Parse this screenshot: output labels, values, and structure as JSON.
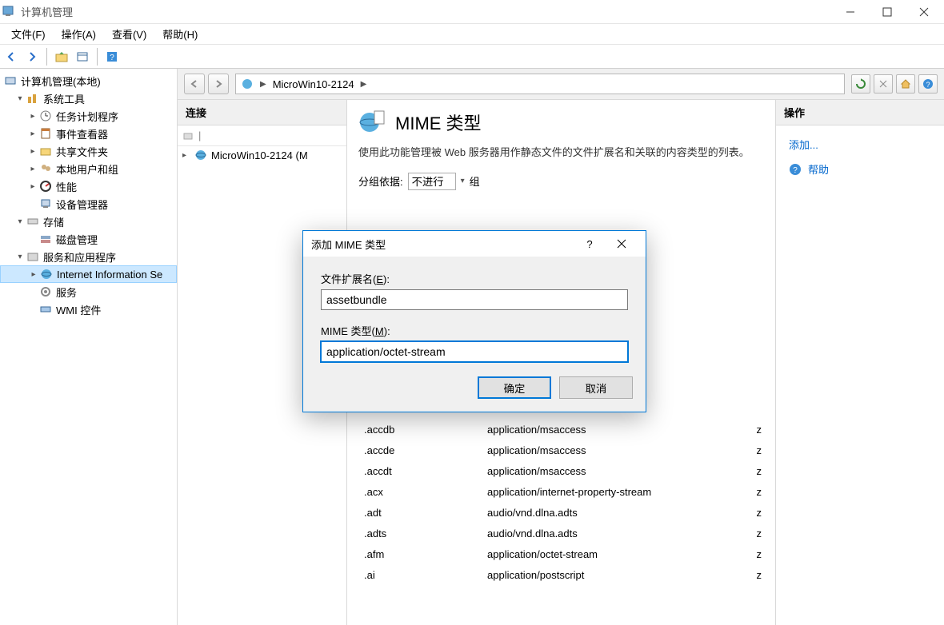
{
  "title": "计算机管理",
  "menubar": [
    "文件(F)",
    "操作(A)",
    "查看(V)",
    "帮助(H)"
  ],
  "tree": {
    "root": "计算机管理(本地)",
    "sys_tools": "系统工具",
    "sys_children": [
      "任务计划程序",
      "事件查看器",
      "共享文件夹",
      "本地用户和组",
      "性能",
      "设备管理器"
    ],
    "storage": "存储",
    "storage_children": [
      "磁盘管理"
    ],
    "services": "服务和应用程序",
    "services_children": [
      "Internet Information Se",
      "服务",
      "WMI 控件"
    ]
  },
  "addressbar": {
    "host": "MicroWin10-2124"
  },
  "left_panel": {
    "header": "连接",
    "node": "MicroWin10-2124 (M"
  },
  "center": {
    "title": "MIME 类型",
    "desc": "使用此功能管理被 Web 服务器用作静态文件的文件扩展名和关联的内容类型的列表。",
    "groupby_label": "分组依据:",
    "groupby_value": "不进行",
    "groupby_suffix": "组",
    "rows": [
      {
        "ext": ".accdb",
        "mime": "application/msaccess"
      },
      {
        "ext": ".accde",
        "mime": "application/msaccess"
      },
      {
        "ext": ".accdt",
        "mime": "application/msaccess"
      },
      {
        "ext": ".acx",
        "mime": "application/internet-property-stream"
      },
      {
        "ext": ".adt",
        "mime": "audio/vnd.dlna.adts"
      },
      {
        "ext": ".adts",
        "mime": "audio/vnd.dlna.adts"
      },
      {
        "ext": ".afm",
        "mime": "application/octet-stream"
      },
      {
        "ext": ".ai",
        "mime": "application/postscript"
      }
    ]
  },
  "right_panel": {
    "header": "操作",
    "add": "添加...",
    "help": "帮助"
  },
  "dialog": {
    "title": "添加 MIME 类型",
    "ext_label_pre": "文件扩展名(",
    "ext_label_u": "E",
    "ext_label_post": "):",
    "ext_value": "assetbundle",
    "mime_label_pre": "MIME 类型(",
    "mime_label_u": "M",
    "mime_label_post": "):",
    "mime_value": "application/octet-stream",
    "ok": "确定",
    "cancel": "取消"
  }
}
